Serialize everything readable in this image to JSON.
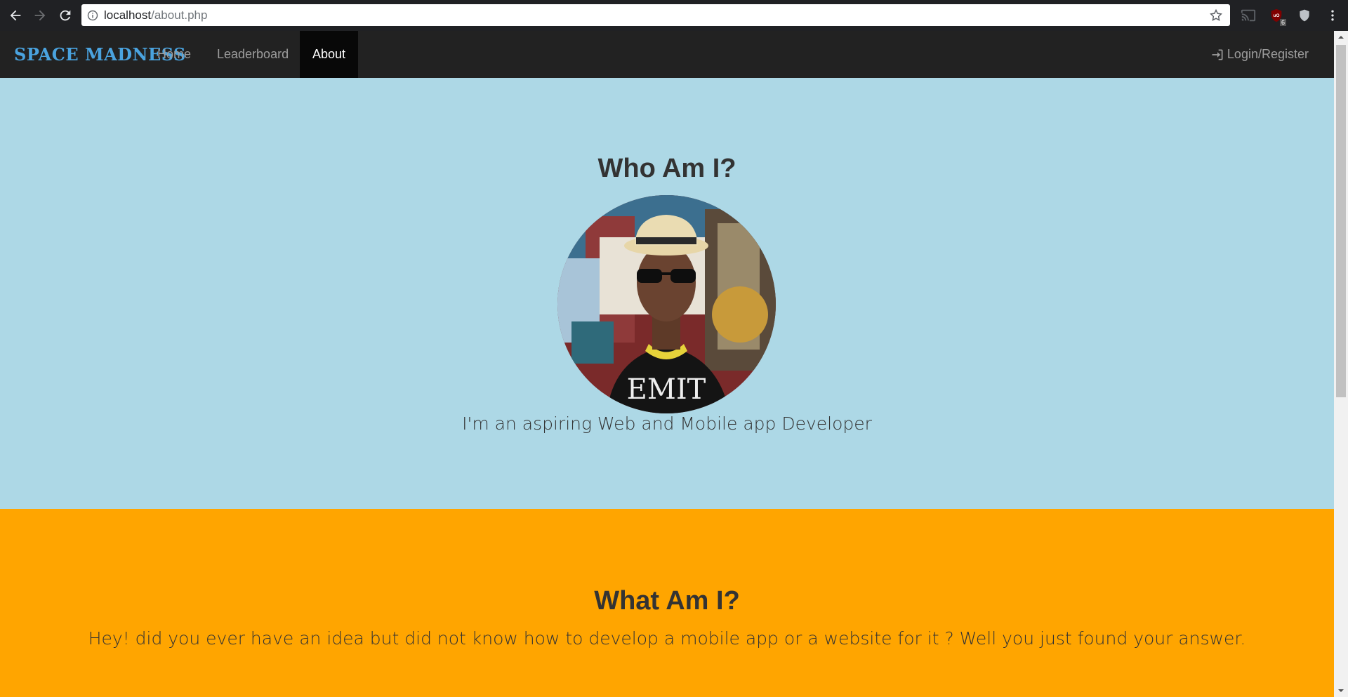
{
  "browser": {
    "url_host": "localhost",
    "url_path": "/about.php",
    "extension_badge": "6"
  },
  "navbar": {
    "brand": "SPACE MADNESS",
    "items": [
      {
        "label": "Home"
      },
      {
        "label": "Leaderboard"
      },
      {
        "label": "About"
      }
    ],
    "login_label": "Login/Register"
  },
  "who": {
    "title": "Who Am I?",
    "text": "I'm an aspiring Web and Mobile app Developer"
  },
  "what": {
    "title": "What Am I?",
    "text": "Hey! did you ever have an idea but did not know how to develop a mobile app or a website for it ? Well you just found your answer."
  },
  "colors": {
    "navbar_bg": "#222222",
    "brand": "#4aa3df",
    "who_bg": "#add8e6",
    "what_bg": "#ffa500"
  }
}
